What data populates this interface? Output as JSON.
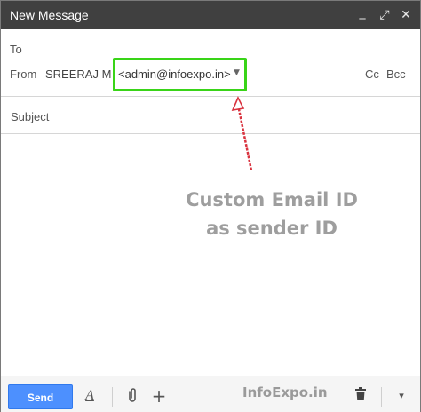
{
  "window": {
    "title": "New Message",
    "minimize_glyph": "_",
    "expand_glyph": "⤢",
    "close_glyph": "✕"
  },
  "header": {
    "to_label": "To",
    "from_label": "From",
    "from_name": "SREERAJ M",
    "from_email": "<admin@infoexpo.in>",
    "cc_label": "Cc",
    "bcc_label": "Bcc",
    "subject_placeholder": "Subject",
    "subject_value": ""
  },
  "annotation": {
    "line1": "Custom Email ID",
    "line2": "as sender ID"
  },
  "footer": {
    "send_label": "Send",
    "formatting_glyph": "A",
    "add_glyph": "+",
    "watermark": "InfoExpo.in",
    "more_glyph": "▾"
  },
  "colors": {
    "titlebar": "#404040",
    "send_button": "#4d90fe",
    "highlight_box": "#39d418",
    "arrow": "#d9333f",
    "annotation_text": "#9e9e9e"
  },
  "icons": [
    "minimize-icon",
    "expand-icon",
    "close-icon",
    "chevron-down-icon",
    "format-text-icon",
    "paperclip-icon",
    "plus-icon",
    "trash-icon"
  ]
}
